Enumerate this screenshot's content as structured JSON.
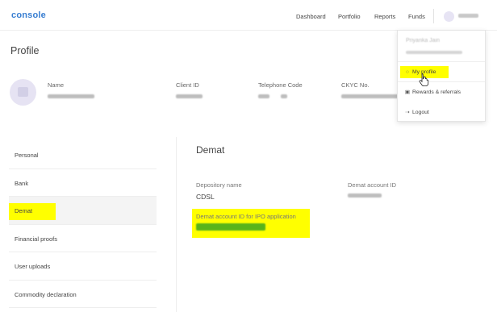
{
  "nav": {
    "logo": "console",
    "links": [
      "Dashboard",
      "Portfolio",
      "Reports",
      "Funds"
    ]
  },
  "page": {
    "title": "Profile"
  },
  "profile_header": {
    "labels": [
      "Name",
      "Client ID",
      "Telephone Code",
      "CKYC No."
    ]
  },
  "sidebar": {
    "items": [
      {
        "label": "Personal"
      },
      {
        "label": "Bank"
      },
      {
        "label": "Demat"
      },
      {
        "label": "Financial proofs"
      },
      {
        "label": "User uploads"
      },
      {
        "label": "Commodity declaration"
      }
    ],
    "active": "Demat"
  },
  "main": {
    "section_title": "Demat",
    "depository_label": "Depository name",
    "depository_value": "CDSL",
    "demat_account_label": "Demat account ID",
    "ipo_label": "Demat account ID for IPO application"
  },
  "dropdown": {
    "user_name": "Priyanka Jain",
    "items": [
      {
        "label": "My profile",
        "icon": "user-icon"
      },
      {
        "label": "Rewards & referrals",
        "icon": "gift-icon"
      },
      {
        "label": "Logout",
        "icon": "logout-icon"
      }
    ]
  },
  "colors": {
    "brand": "#387ed1",
    "highlight": "#ffff00",
    "redacted_green": "#58b41a"
  }
}
